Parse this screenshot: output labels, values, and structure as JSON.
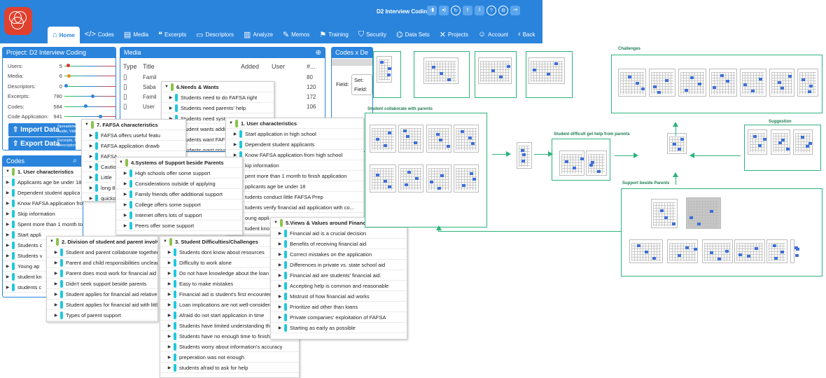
{
  "header": {
    "project_title": "D2 Interview Coding",
    "nav": [
      {
        "label": "Home",
        "icon": "home-icon",
        "glyph": "⌂"
      },
      {
        "label": "Codes",
        "icon": "code-icon",
        "glyph": "</>"
      },
      {
        "label": "Media",
        "icon": "media-icon",
        "glyph": "▤"
      },
      {
        "label": "Excerpts",
        "icon": "excerpt-icon",
        "glyph": "❝"
      },
      {
        "label": "Descriptors",
        "icon": "descriptor-icon",
        "glyph": "▭"
      },
      {
        "label": "Analyze",
        "icon": "analyze-icon",
        "glyph": "▥"
      },
      {
        "label": "Memos",
        "icon": "memo-icon",
        "glyph": "✎"
      },
      {
        "label": "Training",
        "icon": "training-icon",
        "glyph": "⚑"
      },
      {
        "label": "Security",
        "icon": "security-icon",
        "glyph": "⛉"
      },
      {
        "label": "Data Sets",
        "icon": "datasets-icon",
        "glyph": "⌬"
      },
      {
        "label": "Projects",
        "icon": "projects-icon",
        "glyph": "✕"
      },
      {
        "label": "Account",
        "icon": "account-icon",
        "glyph": "☺"
      },
      {
        "label": "Back",
        "icon": "back-icon",
        "glyph": "‹"
      }
    ]
  },
  "project_panel": {
    "title": "Project: D2 Interview Coding",
    "stats": [
      {
        "label": "Users:",
        "value": "5",
        "fraction": 0.05
      },
      {
        "label": "Media:",
        "value": "6",
        "fraction": 0.06
      },
      {
        "label": "Descriptors:",
        "value": "0",
        "fraction": 0.0
      },
      {
        "label": "Excerpts:",
        "value": "780",
        "fraction": 0.55
      },
      {
        "label": "Codes:",
        "value": "584",
        "fraction": 0.4
      },
      {
        "label": "Code Application:",
        "value": "941",
        "fraction": 0.7
      }
    ],
    "import_label": "Import Data",
    "import_sub": "Spreadshe Audio, Vide",
    "export_label": "Export Data",
    "export_sub": "Excerpts, M Descriptors"
  },
  "media_panel": {
    "title": "Media",
    "columns": [
      "Type",
      "Title",
      "Added",
      "User",
      "#..."
    ],
    "rows": [
      {
        "title": "Famil",
        "added": "",
        "user": "",
        "count": "80"
      },
      {
        "title": "Saba",
        "added": "",
        "user": "",
        "count": "120"
      },
      {
        "title": "Famil",
        "added": "",
        "user": "",
        "count": "172"
      },
      {
        "title": "User",
        "added": "",
        "user": "",
        "count": "106"
      }
    ]
  },
  "codes_x_panel": {
    "title": "Codes x De",
    "field_label": "Field:",
    "set_label": "Set:",
    "field2_label": "Field:"
  },
  "codes_panel": {
    "title": "Codes",
    "items": [
      "1. User characteristics",
      "Applicants age be under 18",
      "Dependent student applica",
      "Know FAFSA application from high sc...",
      "Skip information",
      "Spent more than 1 month to finish app...",
      "Start appli",
      "Students c",
      "Students v",
      "Young ap",
      "student kn",
      "students c"
    ]
  },
  "card_needs": {
    "title": "6.Needs & Wants",
    "items": [
      "Students need to do FAFSA right",
      "Students need parents' help",
      "Students need syste",
      "Student wants addit",
      "Students want FAFS",
      "Students want priva"
    ]
  },
  "card_fafsa": {
    "title": "7. FAFSA characteristics",
    "items": [
      "FAFSA offers useful featu",
      "FAFSA application drawb",
      "FAFSA",
      "Cautio",
      "Little",
      "long 8",
      "quicko"
    ]
  },
  "card_user": {
    "title": "1. User characteristics",
    "items": [
      "Start application in high school",
      "Dependent student applicants",
      "Know FAFSA application from high school",
      "kip information",
      "pent more than 1 month to finish application",
      "pplicants age be under 18",
      "tudents conduct little FAFSA Prep",
      "tudents verify financial aid application with co...",
      "oung appli",
      "tudent kno"
    ]
  },
  "card_support": {
    "title": "4.Systems of Support beside Parents",
    "items": [
      "High schools offer some support",
      "Considerations outside of applying",
      "Family friends offer additional support",
      "College offers some support",
      "Internet offers lots of support",
      "Peers offer some support"
    ]
  },
  "card_division": {
    "title": "2. Division of student and parent involvem",
    "items": [
      "Student and parent collaborate together",
      "Parent and child responsibilities unclear",
      "Parent does most work for financial aid",
      "Didn't seek support beside parents",
      "Student applies for financial aid relativel",
      "Student applies for financial aid with littl",
      "Types of parent support"
    ]
  },
  "card_difficulties": {
    "title": "3. Student Difficulties/Challenges",
    "items": [
      "Students dont know about resources",
      "Difficulty to work alone",
      "Do not have knowledge about the loan int",
      "Easy to make mistakes",
      "Financial aid is student's first encounter w",
      "Loan implications are not well-considere",
      "Afraid do not start application in time",
      "Students have limited understanding thro",
      "Students have no enough time to finish",
      "Students worry about information's accuracy",
      "preperation was not enough",
      "students afraid to ask for help"
    ]
  },
  "card_values": {
    "title": "5.Views & Values around Financial Aid",
    "items": [
      "Financial aid is a crucial decision",
      "Benefits of receiving financial aid",
      "Correct mistakes on the application",
      "Differences in private vs. state school aid",
      "Financial aid are students' financial aid.",
      "Accepting help is common and reasonable",
      "Mistrust of how financial aid works",
      "Prioritize aid other than loans",
      "Private companies' exploitation of FAFSA",
      "Starting as early as possible"
    ]
  },
  "graph": {
    "labels": {
      "collab": "Student collaborate with parents",
      "difficult": "Student difficult get help from parents",
      "challenges": "Challenges",
      "suggestion": "Suggestion",
      "support": "Support beside Parents"
    }
  },
  "colors": {
    "accent": "#2a84dc",
    "green": "#2db37b",
    "cyan": "#1ec8dd",
    "lime": "#8bc34a",
    "logo": "#e0402e"
  }
}
